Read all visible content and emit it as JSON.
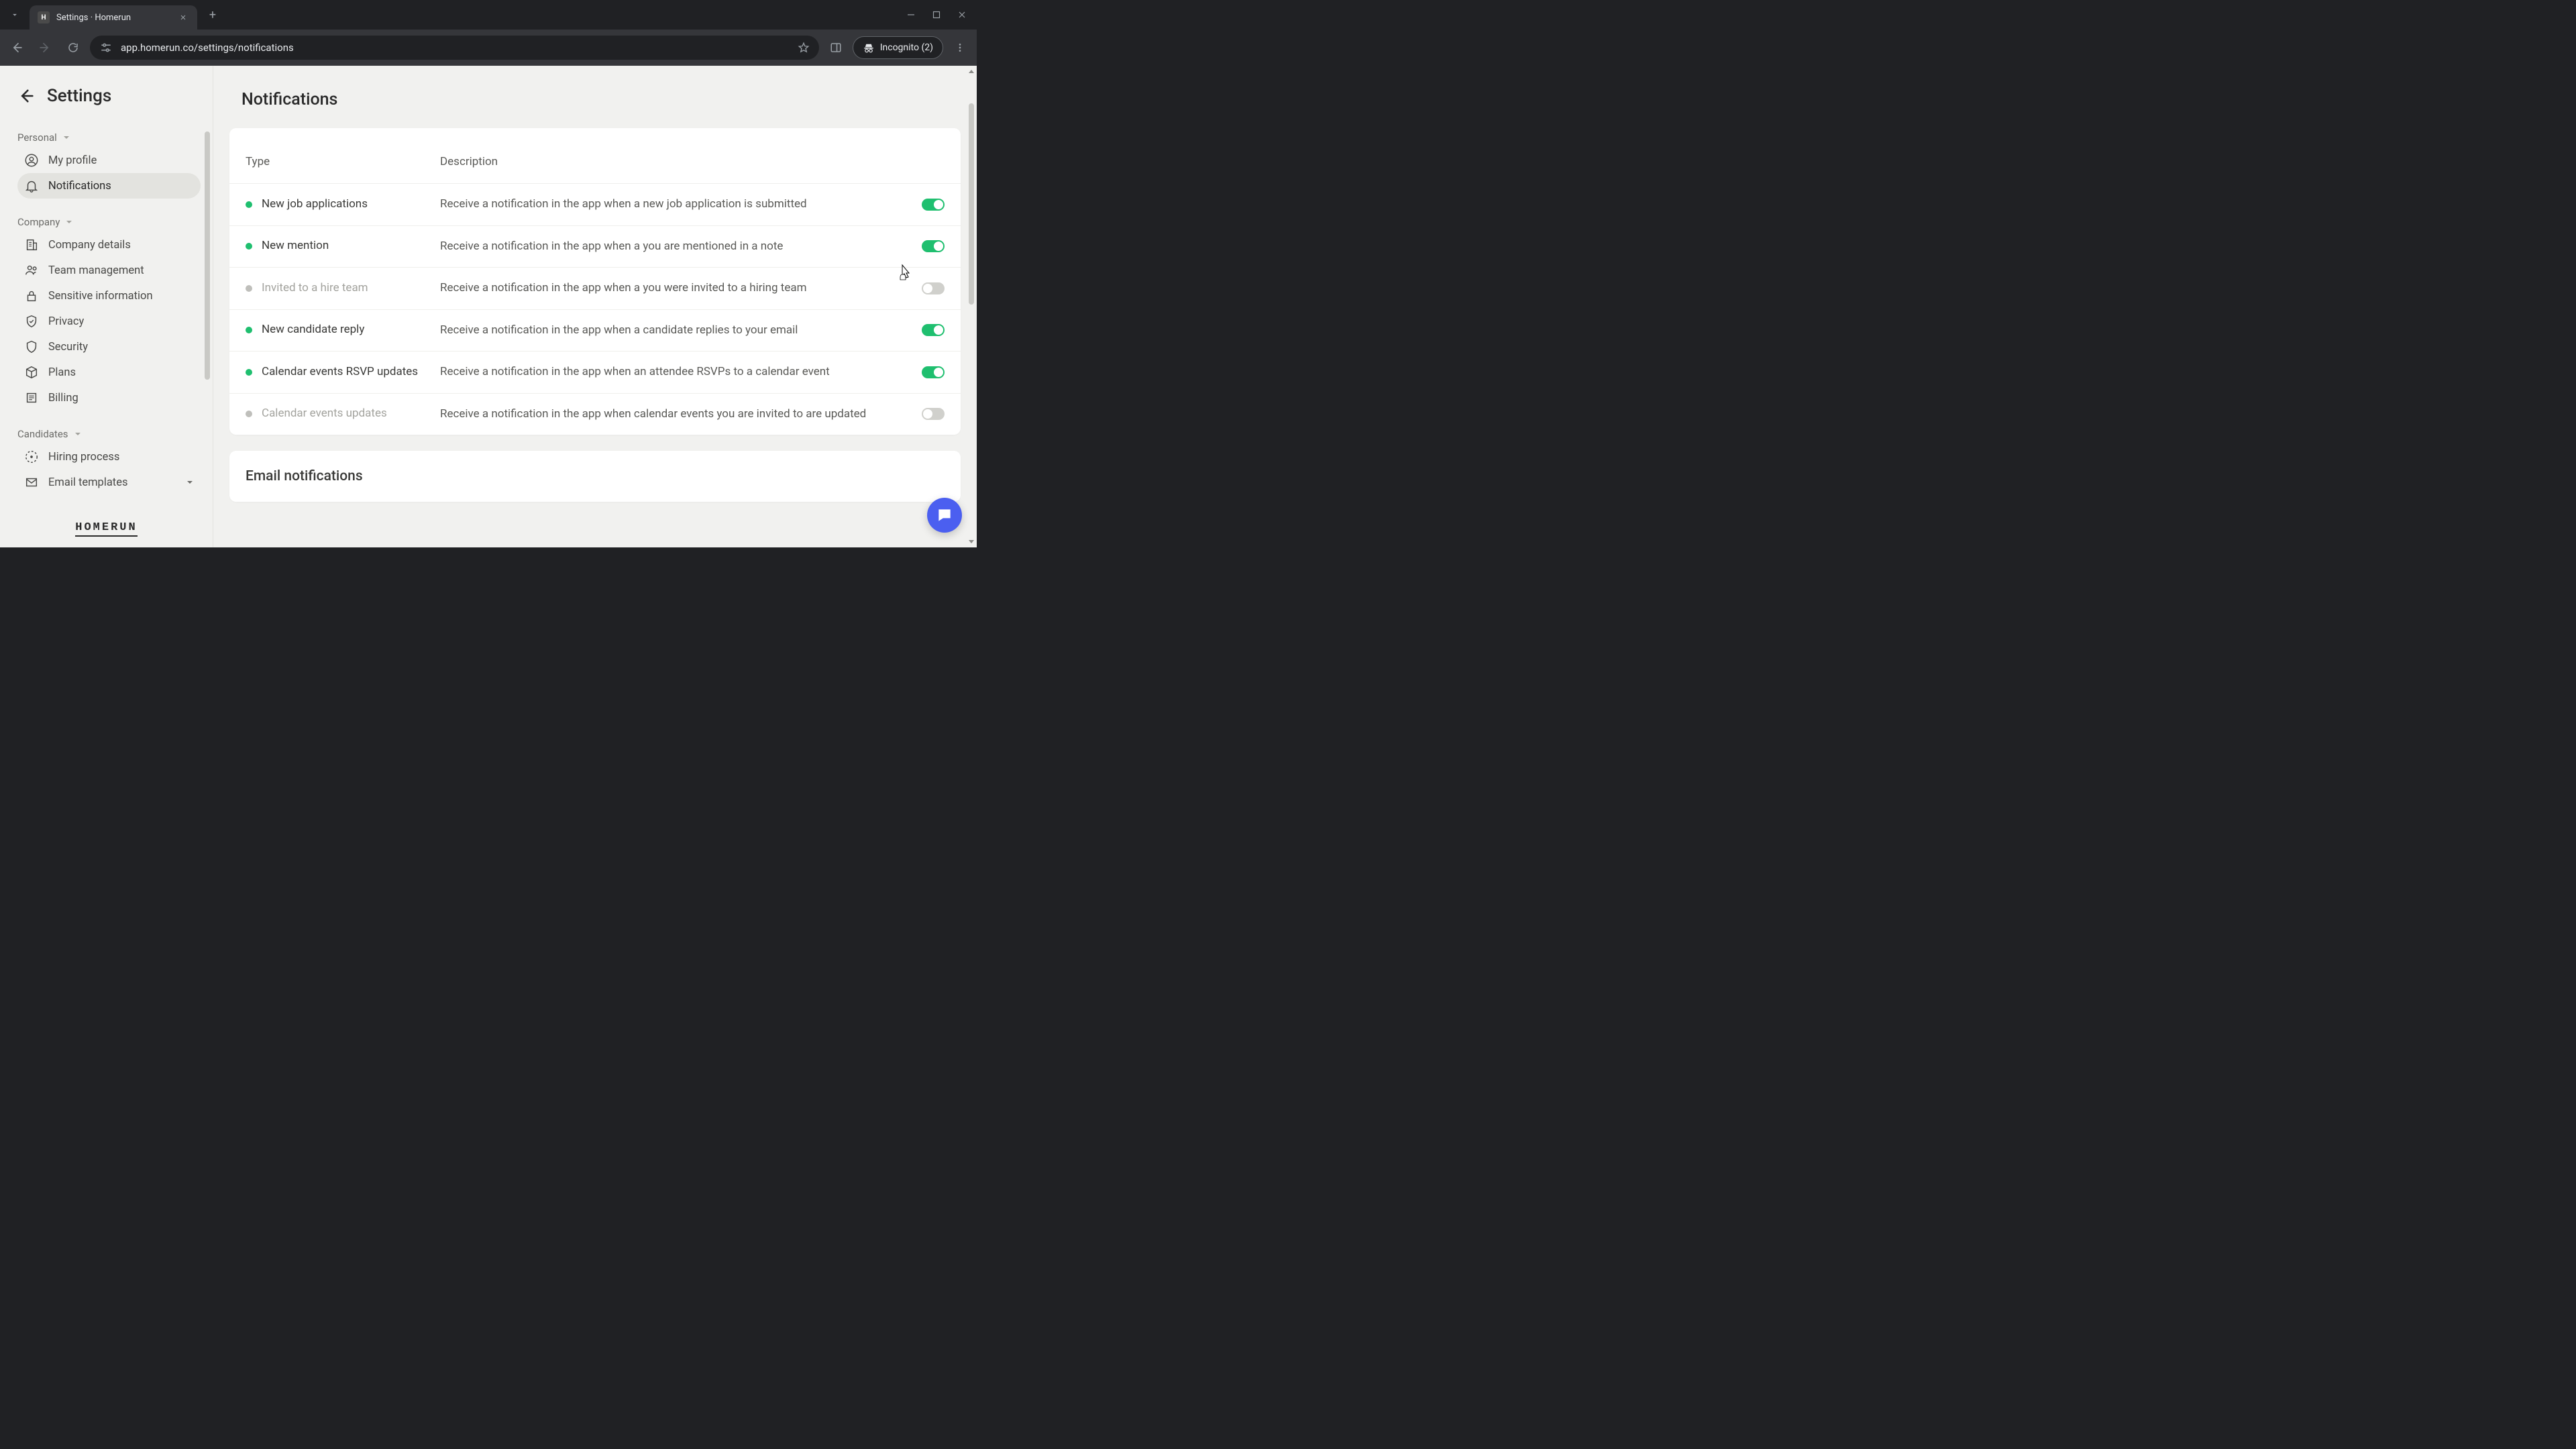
{
  "browser": {
    "tab_title": "Settings · Homerun",
    "url": "app.homerun.co/settings/notifications",
    "incognito_label": "Incognito (2)"
  },
  "sidebar": {
    "title": "Settings",
    "sections": {
      "personal": {
        "label": "Personal"
      },
      "company": {
        "label": "Company"
      },
      "candidates": {
        "label": "Candidates"
      }
    },
    "items": {
      "my_profile": "My profile",
      "notifications": "Notifications",
      "company_details": "Company details",
      "team_management": "Team management",
      "sensitive_information": "Sensitive information",
      "privacy": "Privacy",
      "security": "Security",
      "plans": "Plans",
      "billing": "Billing",
      "hiring_process": "Hiring process",
      "email_templates": "Email templates"
    },
    "logo": "HOMERUN"
  },
  "main": {
    "title": "Notifications",
    "table": {
      "th_type": "Type",
      "th_desc": "Description"
    },
    "rows": [
      {
        "type": "New job applications",
        "desc": "Receive a notification in the app when a new job application is submitted",
        "on": true
      },
      {
        "type": "New mention",
        "desc": "Receive a notification in the app when a you are mentioned in a note",
        "on": true
      },
      {
        "type": "Invited to a hire team",
        "desc": "Receive a notification in the app when a you were invited to a hiring team",
        "on": false
      },
      {
        "type": "New candidate reply",
        "desc": "Receive a notification in the app when a candidate replies to your email",
        "on": true
      },
      {
        "type": "Calendar events RSVP updates",
        "desc": "Receive a notification in the app when an attendee RSVPs to a calen­dar event",
        "on": true
      },
      {
        "type": "Calendar events updates",
        "desc": "Receive a notification in the app when calendar events you are in­vited to are updated",
        "on": false
      }
    ],
    "email_section": "Email notifications"
  }
}
